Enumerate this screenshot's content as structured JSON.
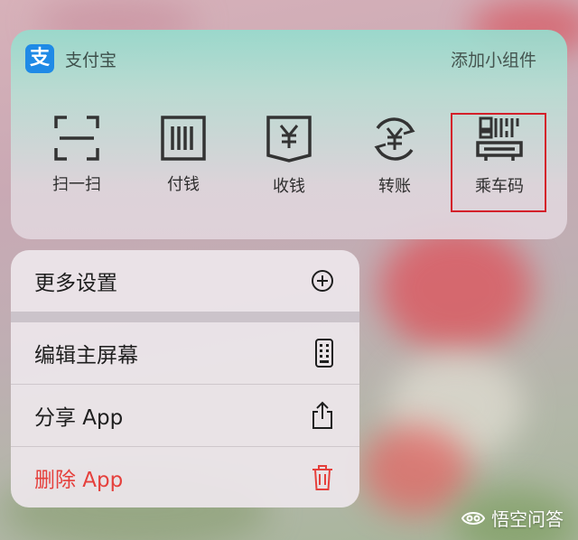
{
  "widget": {
    "app_icon_glyph": "支",
    "app_name": "支付宝",
    "add_widget_label": "添加小组件",
    "actions": [
      {
        "label": "扫一扫",
        "icon": "scan-icon"
      },
      {
        "label": "付钱",
        "icon": "barcode-icon"
      },
      {
        "label": "收钱",
        "icon": "receive-money-icon"
      },
      {
        "label": "转账",
        "icon": "transfer-icon"
      },
      {
        "label": "乘车码",
        "icon": "bus-code-icon"
      }
    ]
  },
  "menu": {
    "items": [
      {
        "label": "更多设置",
        "icon": "plus-circle-icon"
      },
      {
        "label": "编辑主屏幕",
        "icon": "phone-grid-icon"
      },
      {
        "label": "分享 App",
        "icon": "share-icon"
      },
      {
        "label": "删除 App",
        "icon": "trash-icon"
      }
    ]
  },
  "watermark": {
    "text": "悟空问答"
  },
  "colors": {
    "highlight": "#d4202a",
    "danger": "#e5403c",
    "alipay_blue": "#1f8ae6"
  }
}
